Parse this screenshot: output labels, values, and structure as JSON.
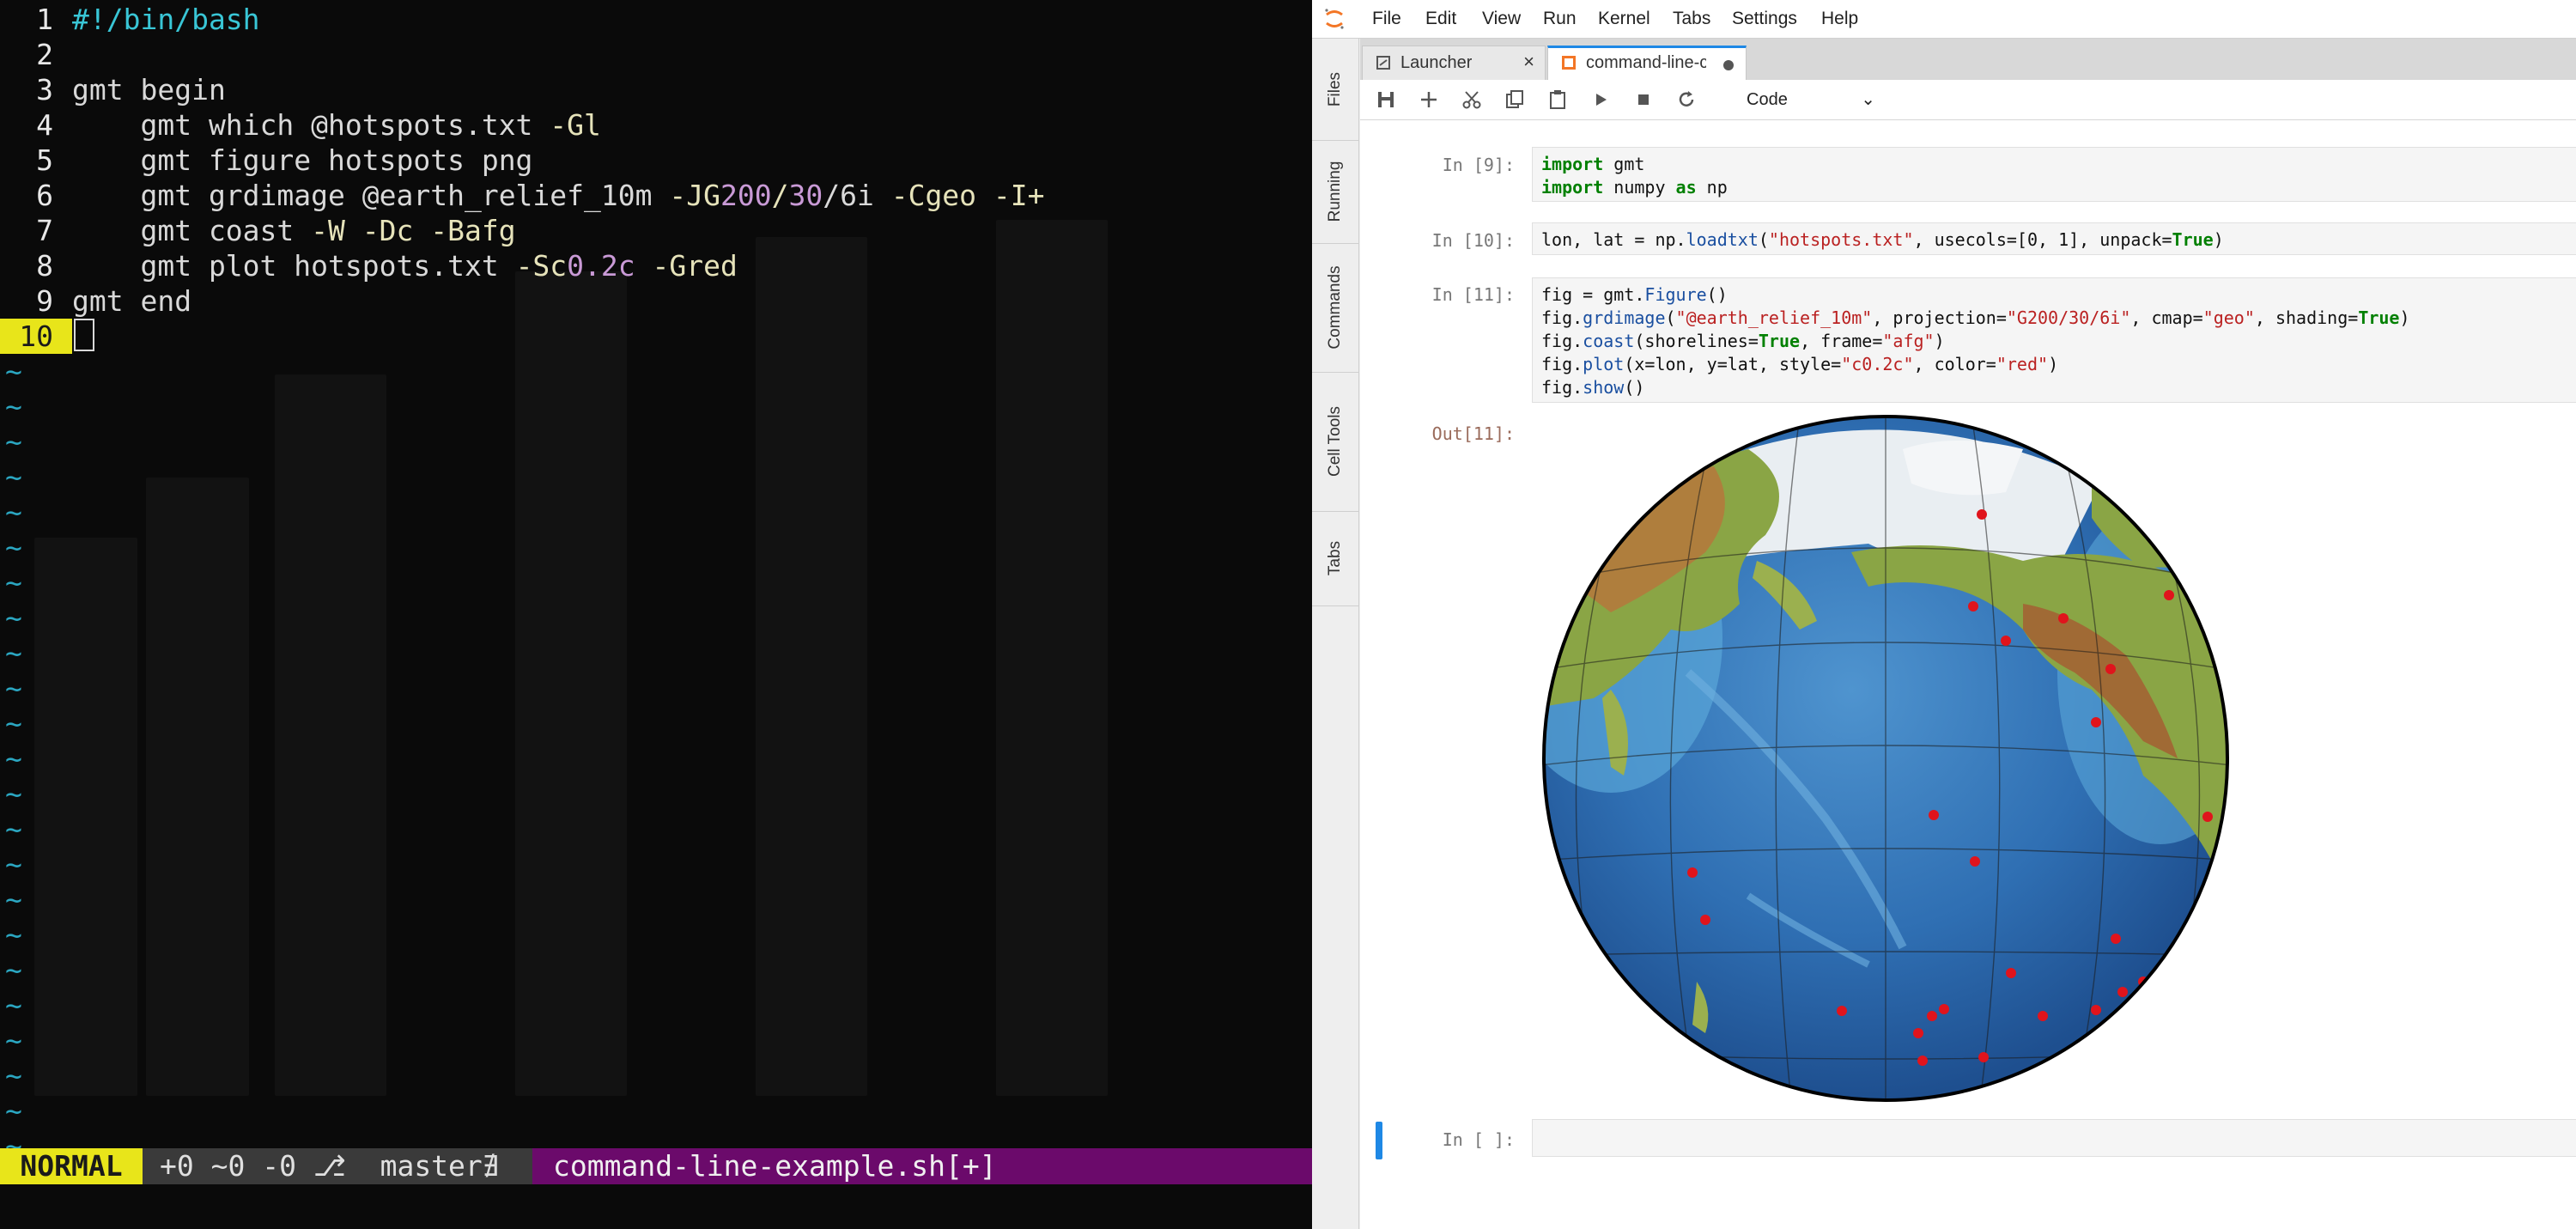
{
  "terminal": {
    "lines": [
      {
        "n": "1",
        "text": "#!/bin/bash"
      },
      {
        "n": "2",
        "text": ""
      },
      {
        "n": "3",
        "text": "gmt begin"
      },
      {
        "n": "4",
        "pre": "    gmt which @hotspots.txt ",
        "flag": "-Gl"
      },
      {
        "n": "5",
        "text": "    gmt figure hotspots png"
      },
      {
        "n": "6",
        "a": "    gmt grdimage @earth_relief_10m ",
        "b": "-JG",
        "c": "200",
        "d": "/",
        "e": "30",
        "f": "/6i ",
        "g": "-Cgeo -I+"
      },
      {
        "n": "7",
        "pre": "    gmt coast ",
        "flag": "-W -Dc -Bafg"
      },
      {
        "n": "8",
        "a": "    gmt plot hotspots.txt ",
        "b": "-Sc",
        "c": "0.2c ",
        "g": "-Gred"
      },
      {
        "n": "9",
        "text": "gmt end"
      },
      {
        "n": "10",
        "text": ""
      }
    ],
    "tilde": "~",
    "status": {
      "mode": "NORMAL",
      "git": "+0 ~0 -0 ⎇  master�After",
      "file": "command-line-example.sh[+]"
    }
  },
  "jupyter": {
    "menu": [
      "File",
      "Edit",
      "View",
      "Run",
      "Kernel",
      "Tabs",
      "Settings",
      "Help"
    ],
    "sidebar": [
      "Files",
      "Running",
      "Commands",
      "Cell Tools",
      "Tabs"
    ],
    "tabs": [
      {
        "label": "Launcher",
        "icon": "rocket-icon",
        "active": false
      },
      {
        "label": "command-line-c",
        "icon": "notebook-icon",
        "active": true
      }
    ],
    "celltype": "Code",
    "cells": [
      {
        "prompt": "In [9]:"
      },
      {
        "prompt": "In [10]:"
      },
      {
        "prompt": "In [11]:"
      },
      {
        "prompt": "Out[11]:"
      },
      {
        "prompt": "In [ ]:"
      }
    ],
    "code": {
      "c9_1_kw": "import",
      "c9_1_rest": " gmt",
      "c9_2_kw": "import",
      "c9_2_mid": " numpy ",
      "c9_2_kw2": "as",
      "c9_2_rest": " np",
      "c10_a": "lon, lat = np.",
      "c10_f": "loadtxt",
      "c10_b": "(",
      "c10_s": "\"hotspots.txt\"",
      "c10_c": ", usecols=[0, 1], unpack=",
      "c10_t": "True",
      "c10_d": ")",
      "c11_1a": "fig = gmt.",
      "c11_1f": "Figure",
      "c11_1b": "()",
      "c11_2a": "fig.",
      "c11_2f": "grdimage",
      "c11_2b": "(",
      "c11_2s1": "\"@earth_relief_10m\"",
      "c11_2c": ", projection=",
      "c11_2s2": "\"G200/30/6i\"",
      "c11_2d": ", cmap=",
      "c11_2s3": "\"geo\"",
      "c11_2e": ", shading=",
      "c11_2t": "True",
      "c11_2g": ")",
      "c11_3a": "fig.",
      "c11_3f": "coast",
      "c11_3b": "(shorelines=",
      "c11_3t": "True",
      "c11_3c": ", frame=",
      "c11_3s": "\"afg\"",
      "c11_3d": ")",
      "c11_4a": "fig.",
      "c11_4f": "plot",
      "c11_4b": "(x=lon, y=lat, style=",
      "c11_4s1": "\"c0.2c\"",
      "c11_4c": ", color=",
      "c11_4s2": "\"red\"",
      "c11_4d": ")",
      "c11_5a": "fig.",
      "c11_5f": "show",
      "c11_5b": "()"
    },
    "colors": {
      "accent": "#1e88e5",
      "hotspot": "#e0141c",
      "ocean_deep": "#2a64a8",
      "land": "#7a9b3a"
    }
  }
}
